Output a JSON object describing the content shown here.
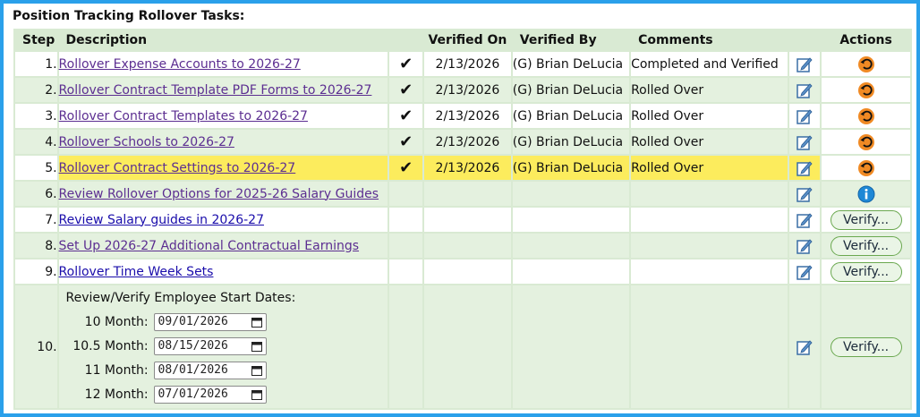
{
  "title": "Position Tracking Rollover Tasks:",
  "headers": {
    "step": "Step",
    "description": "Description",
    "verified_on": "Verified On",
    "verified_by": "Verified By",
    "comments": "Comments",
    "actions": "Actions"
  },
  "rows": [
    {
      "step": "1.",
      "desc": "Rollover Expense Accounts to 2026-27",
      "check": "✔",
      "verified_on": "2/13/2026",
      "verified_by": "(G) Brian DeLucia",
      "comments": "Completed and Verified"
    },
    {
      "step": "2.",
      "desc": "Rollover Contract Template PDF Forms to 2026-27",
      "check": "✔",
      "verified_on": "2/13/2026",
      "verified_by": "(G) Brian DeLucia",
      "comments": "Rolled Over"
    },
    {
      "step": "3.",
      "desc": "Rollover Contract Templates to 2026-27",
      "check": "✔",
      "verified_on": "2/13/2026",
      "verified_by": "(G) Brian DeLucia",
      "comments": "Rolled Over"
    },
    {
      "step": "4.",
      "desc": "Rollover Schools to 2026-27",
      "check": "✔",
      "verified_on": "2/13/2026",
      "verified_by": "(G) Brian DeLucia",
      "comments": "Rolled Over"
    },
    {
      "step": "5.",
      "desc": "Rollover Contract Settings to 2026-27",
      "check": "✔",
      "verified_on": "2/13/2026",
      "verified_by": "(G) Brian DeLucia",
      "comments": "Rolled Over"
    },
    {
      "step": "6.",
      "desc": "Review Rollover Options for 2025-26 Salary Guides"
    },
    {
      "step": "7.",
      "desc": "Review Salary guides in 2026-27",
      "verify": "Verify..."
    },
    {
      "step": "8.",
      "desc": "Set Up 2026-27 Additional Contractual Earnings",
      "verify": "Verify..."
    },
    {
      "step": "9.",
      "desc": "Rollover Time Week Sets",
      "verify": "Verify..."
    },
    {
      "step": "10.",
      "verify": "Verify..."
    }
  ],
  "start_dates": {
    "heading": "Review/Verify Employee Start Dates:",
    "items": [
      {
        "label": "10 Month:",
        "value": "09/01/2026"
      },
      {
        "label": "10.5 Month:",
        "value": "08/15/2026"
      },
      {
        "label": "11 Month:",
        "value": "08/01/2026"
      },
      {
        "label": "12 Month:",
        "value": "07/01/2026"
      }
    ]
  },
  "icons": {
    "edit": "edit-icon",
    "undo": "undo-icon",
    "info": "info-icon",
    "calendar": "calendar-icon"
  },
  "colors": {
    "border": "#2aa0ea",
    "header_bg": "#d9ead3",
    "row_alt": "#e4f1df",
    "highlight": "#fcec5d",
    "undo": "#f08a24",
    "info": "#1e88d6"
  }
}
